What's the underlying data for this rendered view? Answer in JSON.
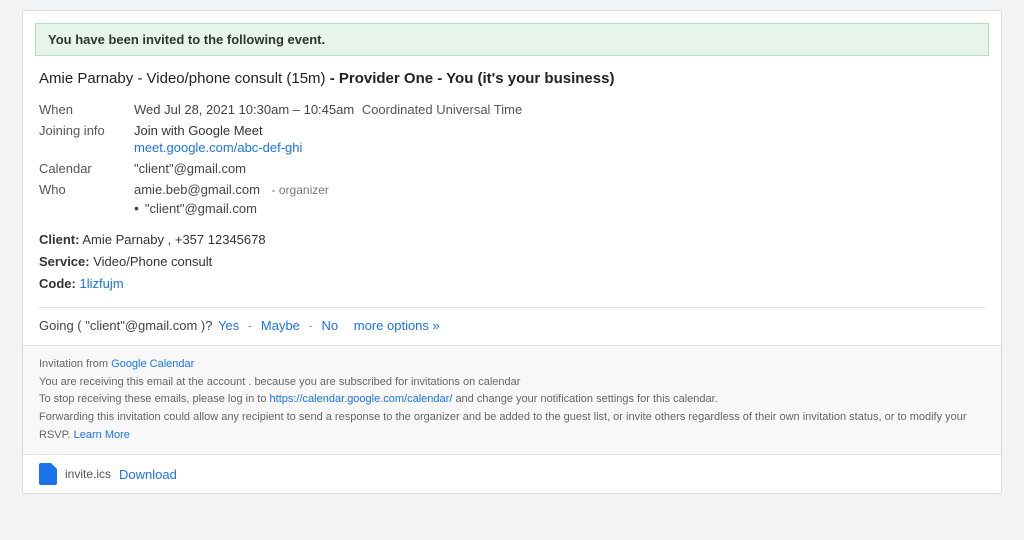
{
  "banner": {
    "text": "You have been invited to the following event."
  },
  "event": {
    "title_normal": "Amie Parnaby - Video/phone consult (15m)",
    "title_bold": "- Provider One - You (it's your business)",
    "when_label": "When",
    "when_value": "Wed Jul 28, 2021 10:30am – 10:45am",
    "when_timezone": "Coordinated Universal Time",
    "joining_label": "Joining info",
    "joining_text": "Join with Google Meet",
    "joining_link": "meet.google.com/abc-def-ghi",
    "calendar_label": "Calendar",
    "calendar_value": "\"client\"@gmail.com",
    "who_label": "Who",
    "who_organizer": "amie.beb@gmail.com",
    "who_organizer_tag": "- organizer",
    "who_attendee": "\"client\"@gmail.com"
  },
  "extra": {
    "client_label": "Client:",
    "client_name": "Amie Parnaby",
    "client_phone": ", +357 12345678",
    "service_label": "Service:",
    "service_value": "Video/Phone consult",
    "code_label": "Code:",
    "code_value": "1lizfujm"
  },
  "going": {
    "prefix": "Going (",
    "email": "\"client\"@gmail.com",
    "suffix": ")? ",
    "yes": "Yes",
    "dash1": "-",
    "maybe": "Maybe",
    "dash2": "-",
    "no": "No",
    "more": "more options »"
  },
  "footer": {
    "invitation_prefix": "Invitation from ",
    "google_calendar": "Google Calendar",
    "google_calendar_href": "https://calendar.google.com/calendar/",
    "line1": "You are receiving this email at the account                                . because you are subscribed for invitations on calendar",
    "line2_prefix": "To stop receiving these emails, please log in to ",
    "line2_link": "https://calendar.google.com/calendar/",
    "line2_suffix": " and change your notification settings for this calendar.",
    "line3": "Forwarding this invitation could allow any recipient to send a response to the organizer and be added to the guest list, or invite others regardless of their own invitation status, or to modify your RSVP. ",
    "learn_more": "Learn More"
  },
  "attachment": {
    "filename": "invite.ics",
    "download_label": "Download"
  }
}
